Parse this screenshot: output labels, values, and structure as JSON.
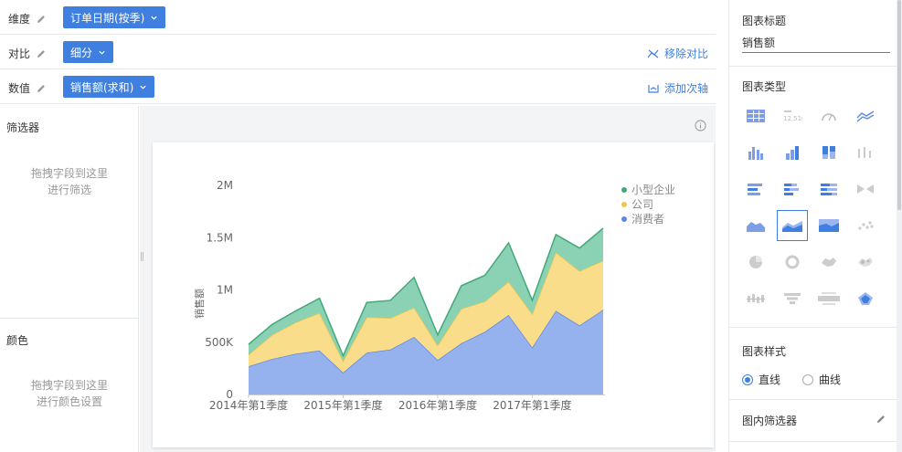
{
  "fields": {
    "dimension": {
      "label": "维度",
      "chip": "订单日期(按季)"
    },
    "compare": {
      "label": "对比",
      "chip": "细分",
      "action": "移除对比"
    },
    "value": {
      "label": "数值",
      "chip": "销售额(求和)",
      "action": "添加次轴"
    }
  },
  "left_panel": {
    "filter_title": "筛选器",
    "filter_hint_1": "拖拽字段到这里",
    "filter_hint_2": "进行筛选",
    "color_title": "颜色",
    "color_hint_1": "拖拽字段到这里",
    "color_hint_2": "进行颜色设置"
  },
  "config": {
    "chart_title_label": "图表标题",
    "chart_title_value": "销售额",
    "chart_type_label": "图表类型",
    "chart_style_label": "图表样式",
    "style_options": [
      "直线",
      "曲线"
    ],
    "style_selected": "直线",
    "inner_filter_label": "图内筛选器",
    "selected_type": "stacked-area"
  },
  "colors": {
    "accent": "#3e7fe0",
    "series_small_business": "#8bd1b3",
    "series_company": "#f9dd8b",
    "series_consumer": "#95b2ef"
  },
  "chart_data": {
    "type": "area",
    "stacked": true,
    "ylabel": "销售额",
    "ylim": [
      0,
      2000000
    ],
    "y_ticks": [
      0,
      500000,
      1000000,
      1500000,
      2000000
    ],
    "y_tick_labels": [
      "0",
      "500K",
      "1M",
      "1.5M",
      "2M"
    ],
    "x_tick_labels": [
      "2014年第1季度",
      "2015年第1季度",
      "2016年第1季度",
      "2017年第1季度"
    ],
    "legend_position": "top-right",
    "x": [
      "2014Q1",
      "2014Q2",
      "2014Q3",
      "2014Q4",
      "2015Q1",
      "2015Q2",
      "2015Q3",
      "2015Q4",
      "2016Q1",
      "2016Q2",
      "2016Q3",
      "2016Q4",
      "2017Q1",
      "2017Q2",
      "2017Q3",
      "2017Q4"
    ],
    "series": [
      {
        "name": "消费者",
        "color": "#95b2ef",
        "line": "#5f87e0",
        "values": [
          270000,
          340000,
          390000,
          420000,
          210000,
          400000,
          430000,
          550000,
          330000,
          490000,
          600000,
          760000,
          450000,
          800000,
          660000,
          810000
        ]
      },
      {
        "name": "公司",
        "color": "#f9dd8b",
        "line": "#f0c64a",
        "values": [
          110000,
          230000,
          300000,
          360000,
          110000,
          340000,
          300000,
          280000,
          140000,
          330000,
          290000,
          320000,
          320000,
          560000,
          520000,
          470000
        ]
      },
      {
        "name": "小型企业",
        "color": "#8bd1b3",
        "line": "#43a87a",
        "values": [
          100000,
          100000,
          110000,
          140000,
          50000,
          140000,
          170000,
          290000,
          100000,
          220000,
          250000,
          370000,
          130000,
          170000,
          220000,
          310000
        ]
      }
    ],
    "legend": [
      "小型企业",
      "公司",
      "消费者"
    ]
  }
}
